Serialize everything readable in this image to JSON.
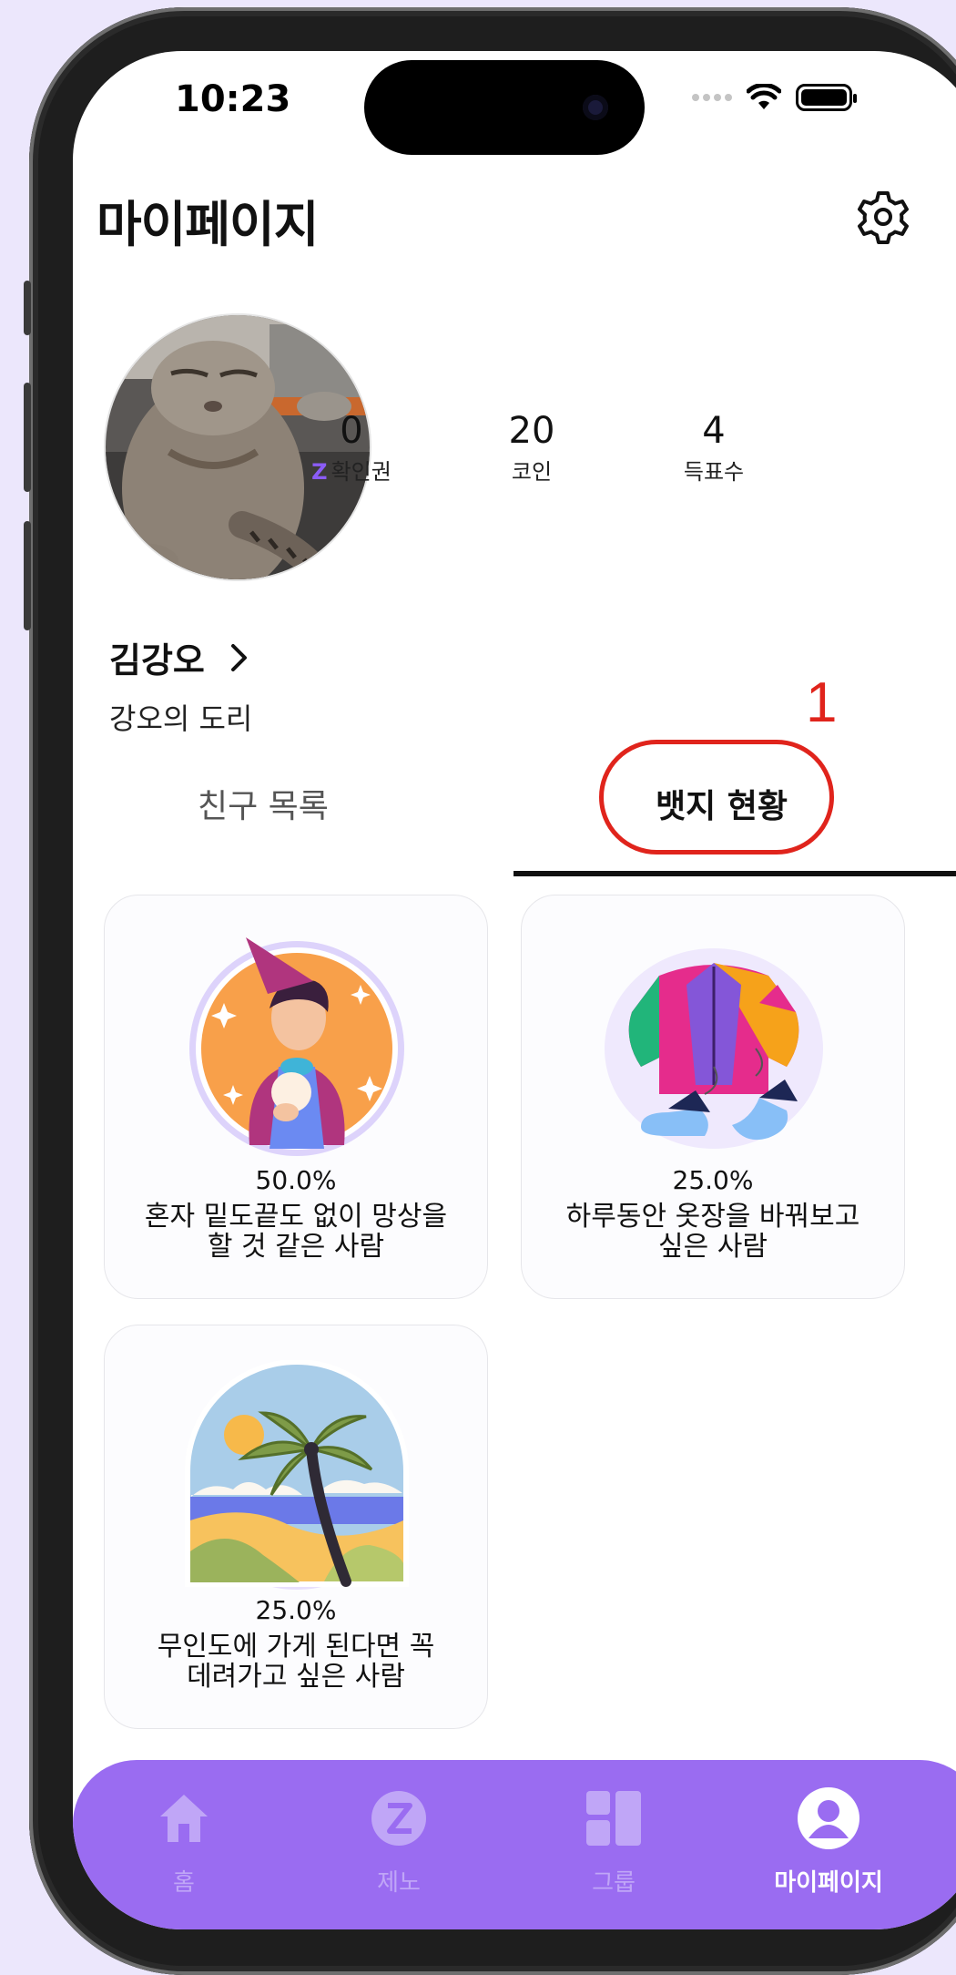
{
  "status_bar": {
    "time": "10:23"
  },
  "header": {
    "title": "마이페이지"
  },
  "profile": {
    "stats": [
      {
        "value": "0",
        "prefix": "Z",
        "label": "확인권"
      },
      {
        "value": "20",
        "label": "코인"
      },
      {
        "value": "4",
        "label": "득표수"
      }
    ],
    "name": "김강오",
    "bio": "강오의 도리"
  },
  "annotation": {
    "label": "1",
    "color": "#e0241c"
  },
  "tabs": {
    "friends": "친구 목록",
    "badges": "뱃지 현황"
  },
  "badges": [
    {
      "percent": "50.0%",
      "line1": "혼자 밑도끝도 없이 망상을",
      "line2": "할 것 같은 사람"
    },
    {
      "percent": "25.0%",
      "line1": "하루동안 옷장을 바꿔보고",
      "line2": "싶은 사람"
    },
    {
      "percent": "25.0%",
      "line1": "무인도에 가게 된다면 꼭",
      "line2": "데려가고 싶은 사람"
    }
  ],
  "tab_bar": {
    "items": [
      {
        "label": "홈",
        "icon": "home-icon"
      },
      {
        "label": "제노",
        "icon": "zeno-icon"
      },
      {
        "label": "그룹",
        "icon": "group-icon"
      },
      {
        "label": "마이페이지",
        "icon": "profile-icon"
      }
    ],
    "active": "마이페이지",
    "color": "#9a6cf1"
  }
}
